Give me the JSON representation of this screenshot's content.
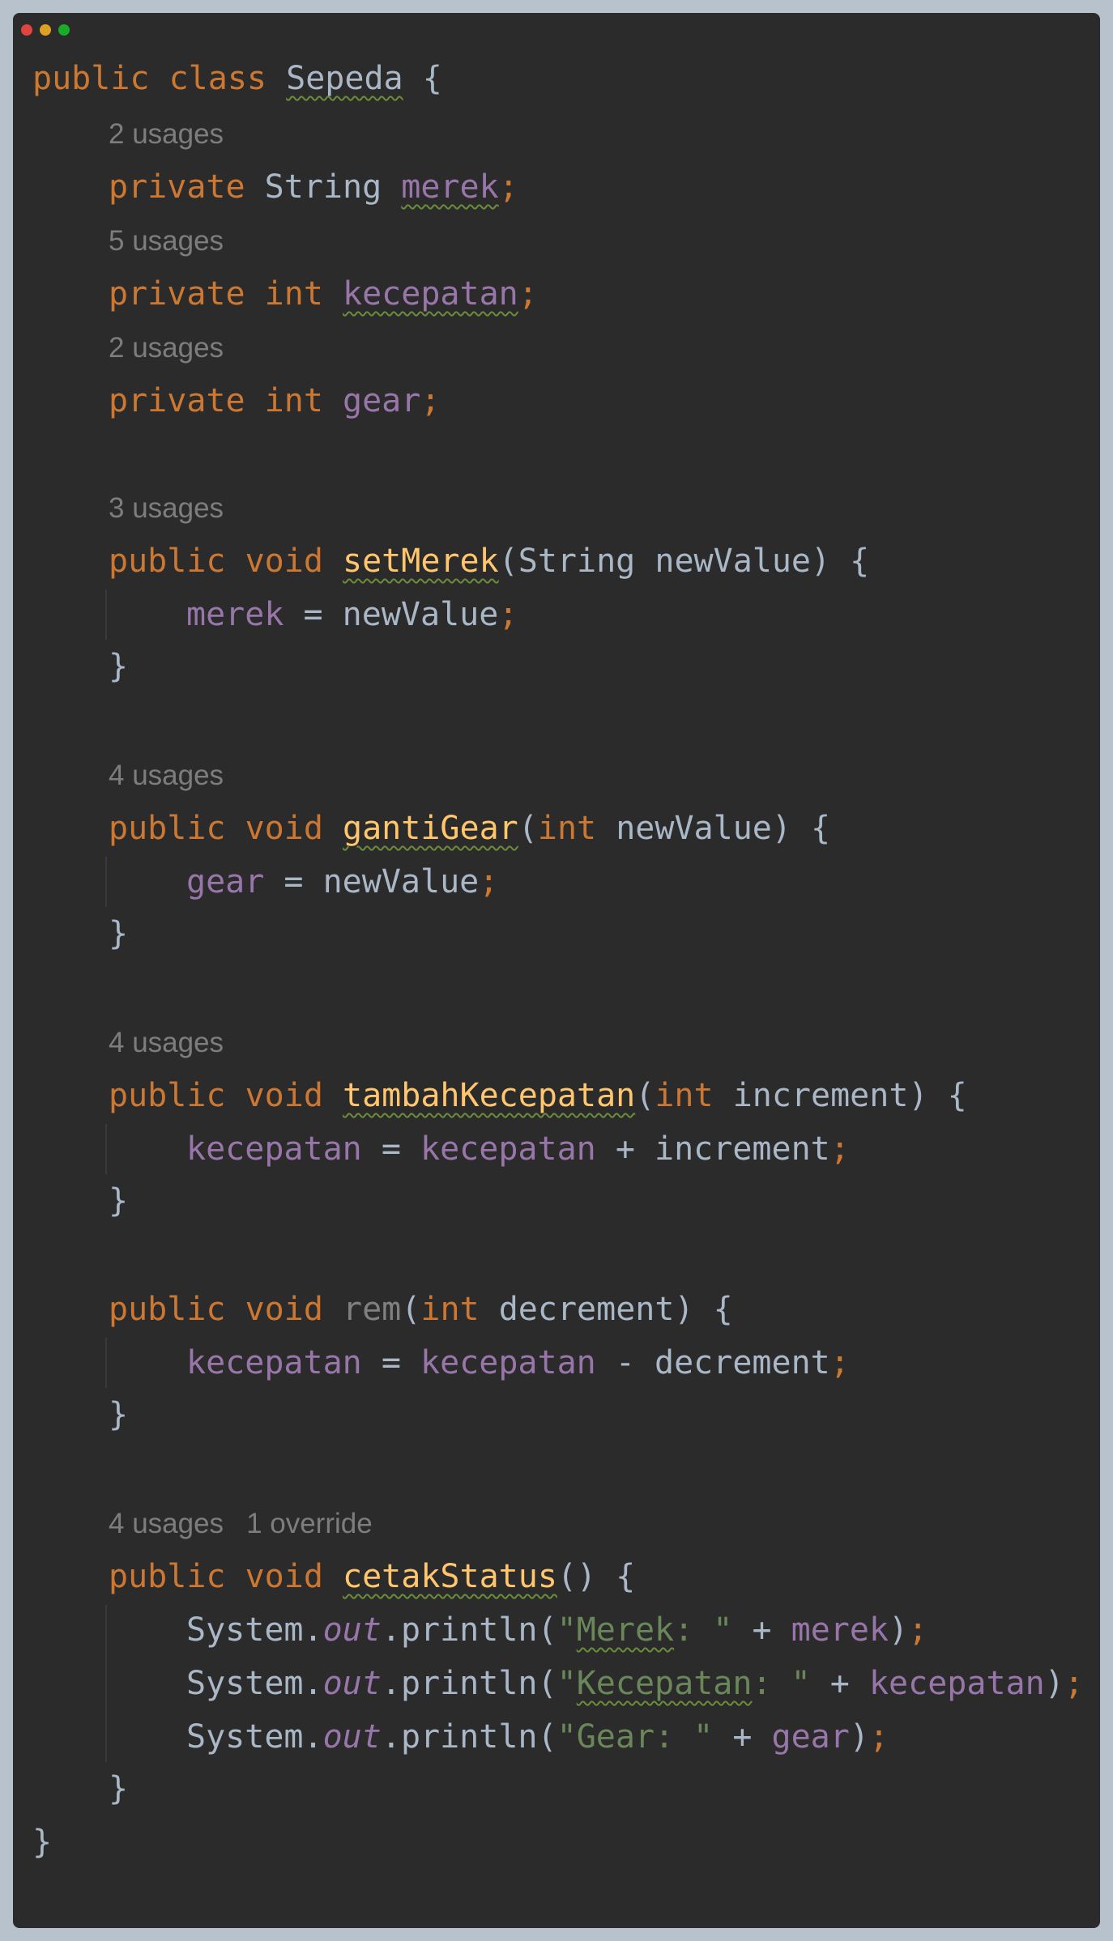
{
  "window": {
    "colors": {
      "close": "#e0443e",
      "minimize": "#dea123",
      "maximize": "#1aab29",
      "background": "#2b2b2b"
    }
  },
  "hints": {
    "merek": "2 usages",
    "kecepatan": "5 usages",
    "gear": "2 usages",
    "setMerek": "3 usages",
    "gantiGear": "4 usages",
    "tambahKecepatan": "4 usages",
    "cetakStatus_usages": "4 usages",
    "cetakStatus_override": "1 override"
  },
  "tokens": {
    "public": "public",
    "private": "private",
    "class": "class",
    "void": "void",
    "int": "int",
    "String": "String",
    "Sepeda": "Sepeda",
    "merek": "merek",
    "kecepatan": "kecepatan",
    "gear": "gear",
    "setMerek": "setMerek",
    "gantiGear": "gantiGear",
    "tambahKecepatan": "tambahKecepatan",
    "rem": "rem",
    "cetakStatus": "cetakStatus",
    "newValue": "newValue",
    "increment": "increment",
    "decrement": "decrement",
    "System": "System",
    "out": "out",
    "println": "println",
    "str_merek_open": "\"",
    "str_merek_word": "Merek",
    "str_merek_close": ": \"",
    "str_kec_open": "\"",
    "str_kec_word": "Kecepatan",
    "str_kec_close": ": \"",
    "str_gear": "\"Gear: \""
  }
}
